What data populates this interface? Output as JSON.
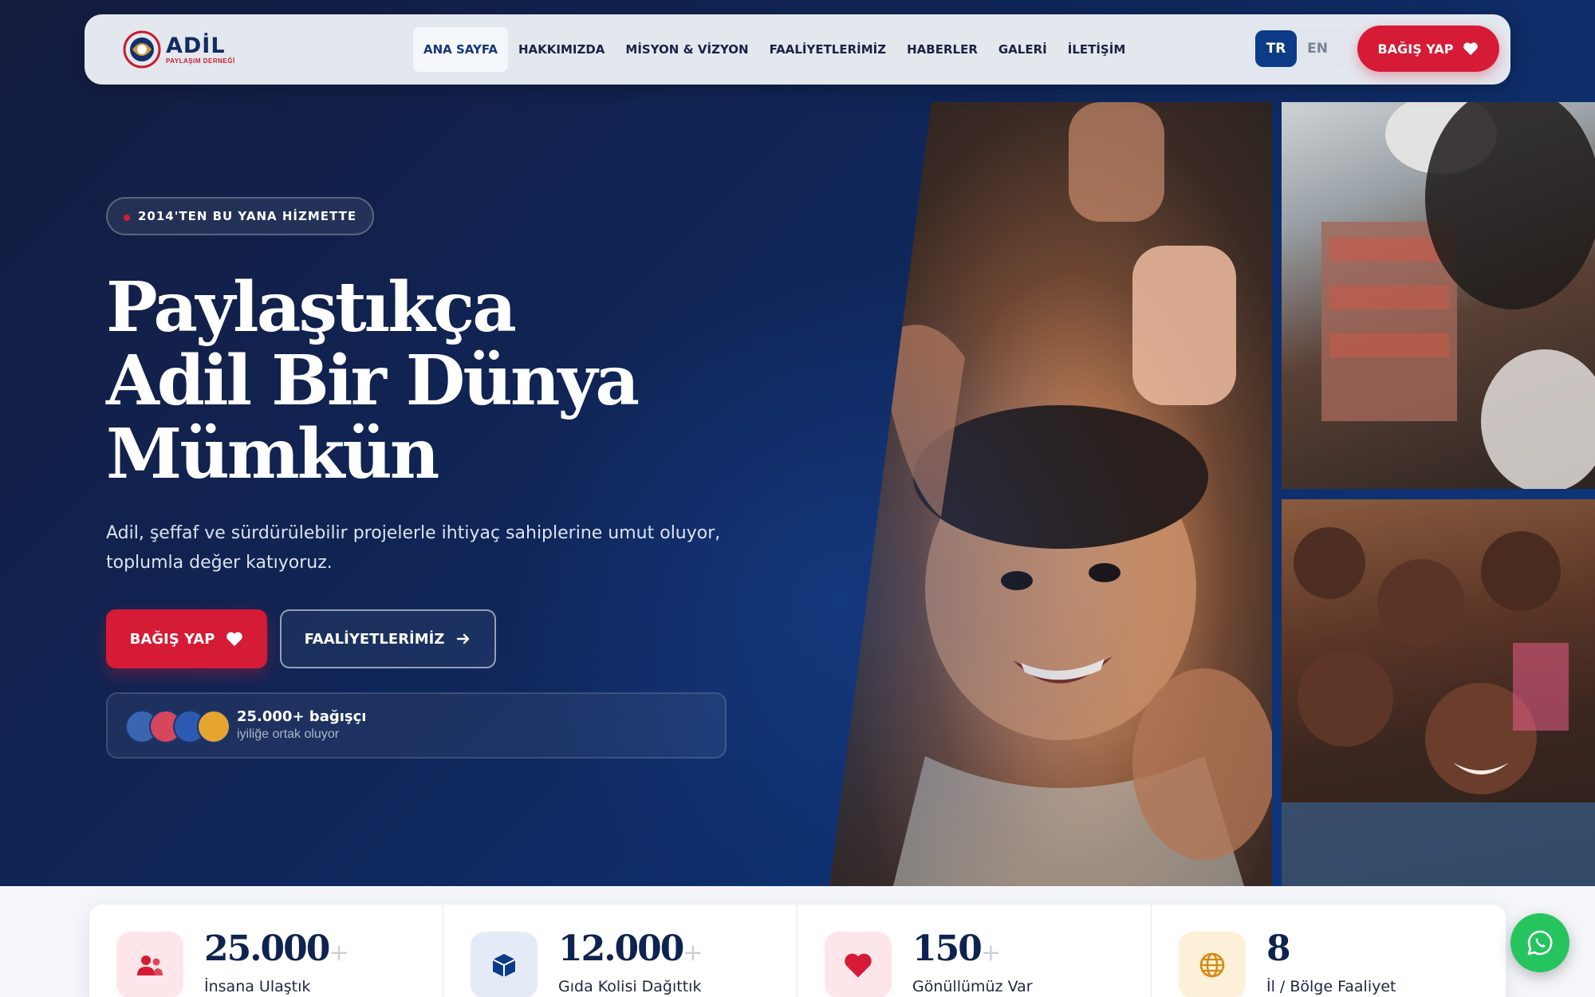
{
  "brand": {
    "name": "ADİL",
    "tagline": "PAYLAŞIM DERNEĞİ",
    "colors": {
      "primary": "#0d3b87",
      "accent": "#d51b35"
    }
  },
  "nav": {
    "items": [
      {
        "label": "ANA SAYFA",
        "active": true
      },
      {
        "label": "HAKKIMIZDA"
      },
      {
        "label": "MİSYON & VİZYON"
      },
      {
        "label": "FAALİYETLERİMİZ"
      },
      {
        "label": "HABERLER"
      },
      {
        "label": "GALERİ"
      },
      {
        "label": "İLETİŞİM"
      }
    ],
    "lang": {
      "tr": "TR",
      "en": "EN",
      "selected": "TR"
    },
    "donate_label": "BAĞIŞ YAP"
  },
  "hero": {
    "badge": "2014'TEN BU YANA HİZMETTE",
    "headline": [
      "Paylaştıkça",
      "Adil Bir Dünya",
      "Mümkün"
    ],
    "subtext": "Adil, şeffaf ve sürdürülebilir projelerle ihtiyaç sahiplerine umut oluyor, toplumla değer katıyoruz.",
    "donate_button": "BAĞIŞ YAP",
    "activities_button": "FAALİYETLERİMİZ",
    "donors": {
      "count": "25.000+ bağışçı",
      "subtitle": "iyiliğe ortak oluyor"
    }
  },
  "stats": [
    {
      "value": "25.000",
      "plus": "+",
      "label": "İnsana Ulaştık",
      "icon": "users-icon",
      "color": "#d51b35"
    },
    {
      "value": "12.000",
      "plus": "+",
      "label": "Gıda Kolisi Dağıttık",
      "icon": "box-icon",
      "color": "#0d3b87"
    },
    {
      "value": "150",
      "plus": "+",
      "label": "Gönüllümüz Var",
      "icon": "heart-icon",
      "color": "#d51b35"
    },
    {
      "value": "8",
      "plus": "",
      "label": "İl / Bölge Faaliyet",
      "icon": "globe-icon",
      "color": "#d68a12"
    }
  ]
}
